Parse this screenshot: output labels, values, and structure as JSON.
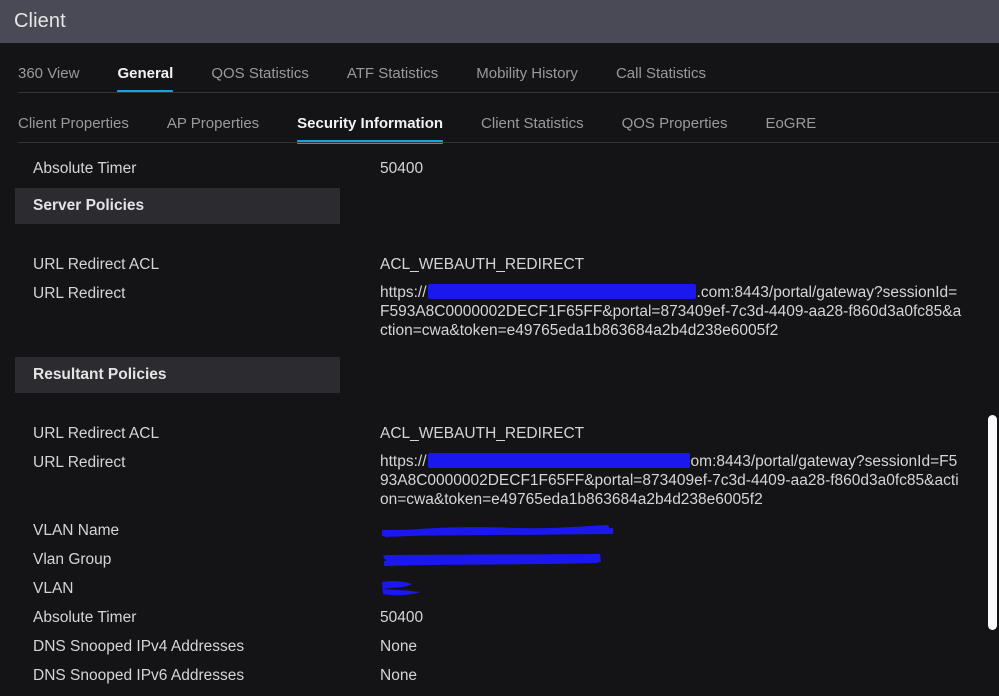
{
  "window": {
    "title": "Client"
  },
  "primary_tabs": [
    {
      "label": "360 View",
      "active": false
    },
    {
      "label": "General",
      "active": true
    },
    {
      "label": "QOS Statistics",
      "active": false
    },
    {
      "label": "ATF Statistics",
      "active": false
    },
    {
      "label": "Mobility History",
      "active": false
    },
    {
      "label": "Call Statistics",
      "active": false
    }
  ],
  "secondary_tabs": [
    {
      "label": "Client Properties",
      "active": false
    },
    {
      "label": "AP Properties",
      "active": false
    },
    {
      "label": "Security Information",
      "active": true
    },
    {
      "label": "Client Statistics",
      "active": false
    },
    {
      "label": "QOS Properties",
      "active": false
    },
    {
      "label": "EoGRE",
      "active": false
    }
  ],
  "colors": {
    "accent": "#1ba0da",
    "titlebar": "#4a4a57",
    "background": "#141416",
    "section_band": "#2b2b30",
    "redaction": "#1a18ee",
    "scrollbar_thumb": "#fbfbfb"
  },
  "rows": {
    "absolute_timer_top_label": "Absolute Timer",
    "absolute_timer_top_value": "50400",
    "server_policies_header": "Server Policies",
    "server_url_redirect_acl_label": "URL Redirect ACL",
    "server_url_redirect_acl_value": "ACL_WEBAUTH_REDIRECT",
    "server_url_redirect_label": "URL Redirect",
    "server_url_redirect_prefix": "https://",
    "server_url_redirect_suffix": ".com:8443/portal/gateway?sessionId=F593A8C0000002DECF1F65FF&portal=873409ef-7c3d-4409-aa28-f860d3a0fc85&action=cwa&token=e49765eda1b863684a2b4d238e6005f2",
    "resultant_policies_header": "Resultant Policies",
    "resultant_url_redirect_acl_label": "URL Redirect ACL",
    "resultant_url_redirect_acl_value": "ACL_WEBAUTH_REDIRECT",
    "resultant_url_redirect_label": "URL Redirect",
    "resultant_url_redirect_prefix": "https://",
    "resultant_url_redirect_suffix": "om:8443/portal/gateway?sessionId=F593A8C0000002DECF1F65FF&portal=873409ef-7c3d-4409-aa28-f860d3a0fc85&action=cwa&token=e49765eda1b863684a2b4d238e6005f2",
    "vlan_name_label": "VLAN Name",
    "vlan_name_value": "",
    "vlan_group_label": "Vlan Group",
    "vlan_group_value": "",
    "vlan_label": "VLAN",
    "vlan_value": "",
    "absolute_timer_bottom_label": "Absolute Timer",
    "absolute_timer_bottom_value": "50400",
    "dns_ipv4_label": "DNS Snooped IPv4 Addresses",
    "dns_ipv4_value": "None",
    "dns_ipv6_label": "DNS Snooped IPv6 Addresses",
    "dns_ipv6_value": "None"
  }
}
